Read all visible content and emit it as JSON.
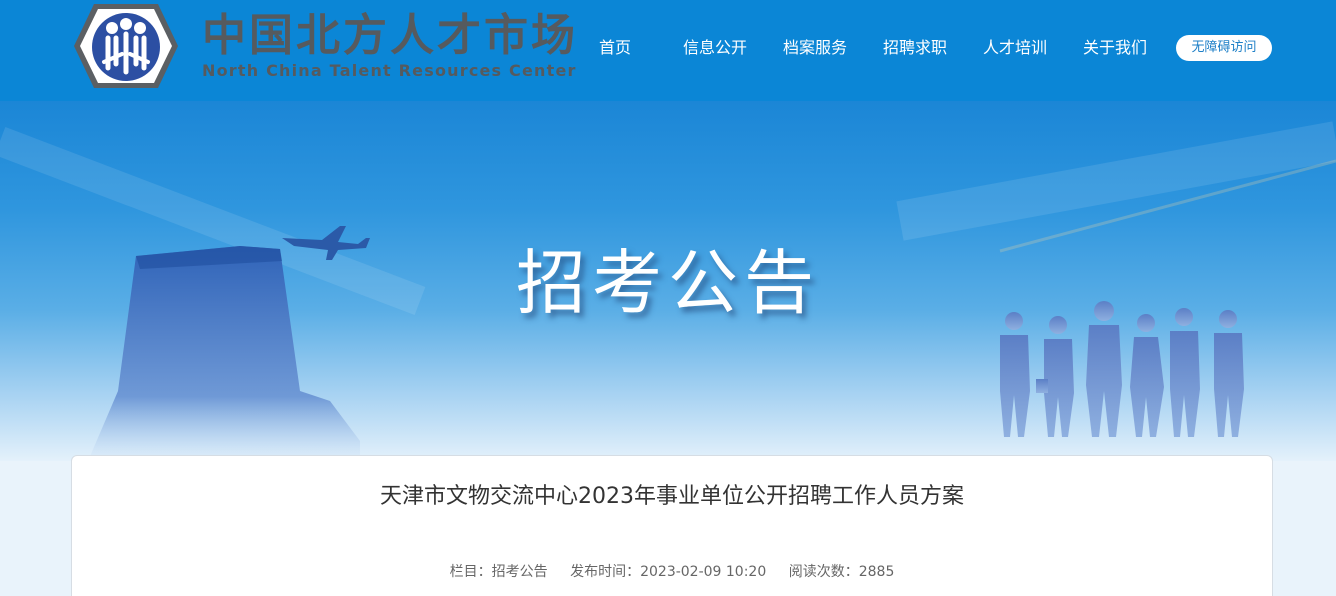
{
  "header": {
    "logo_cn": "中国北方人才市场",
    "logo_en": "North China Talent Resources Center",
    "nav": [
      {
        "label": "首页"
      },
      {
        "label": "信息公开"
      },
      {
        "label": "档案服务"
      },
      {
        "label": "招聘求职"
      },
      {
        "label": "人才培训"
      },
      {
        "label": "关于我们"
      }
    ],
    "accessibility_label": "无障碍访问"
  },
  "banner": {
    "title": "招考公告"
  },
  "article": {
    "title": "天津市文物交流中心2023年事业单位公开招聘工作人员方案",
    "meta": {
      "column": "栏目：招考公告",
      "published": "发布时间：2023-02-09 10:20",
      "views": "阅读次数：2885"
    }
  },
  "colors": {
    "header_bg": "#0b86d6",
    "logo_text": "#565a5e",
    "logo_blue": "#2c4fa3",
    "button_text": "#1d7fc7"
  }
}
